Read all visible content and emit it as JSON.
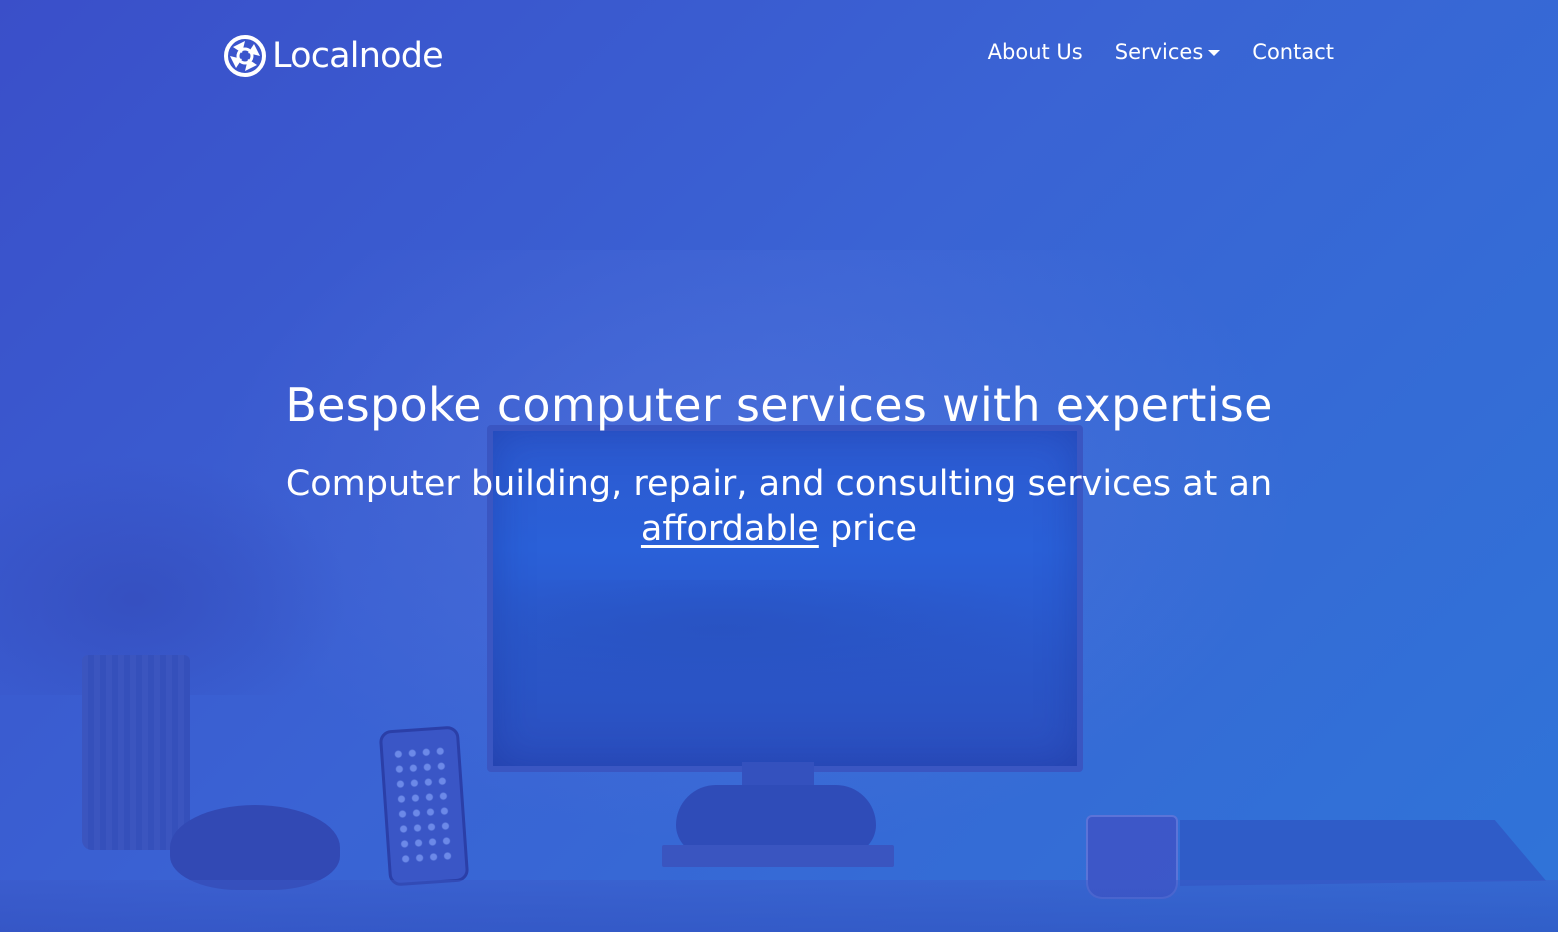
{
  "brand": {
    "name": "Localnode",
    "logo_icon": "recycle-arrows-icon"
  },
  "nav": {
    "items": [
      {
        "label": "About Us"
      },
      {
        "label": "Services",
        "icon": "caret-down-icon"
      },
      {
        "label": "Contact"
      }
    ]
  },
  "hero": {
    "headline": "Bespoke computer services with expertise",
    "subhead_part1": "Computer building, repair, and consulting services at an",
    "subhead_link": "affordable",
    "subhead_part2": "price"
  },
  "colors": {
    "overlay_start": "#3a4fc9",
    "overlay_end": "#2f74d8",
    "text": "#ffffff"
  }
}
